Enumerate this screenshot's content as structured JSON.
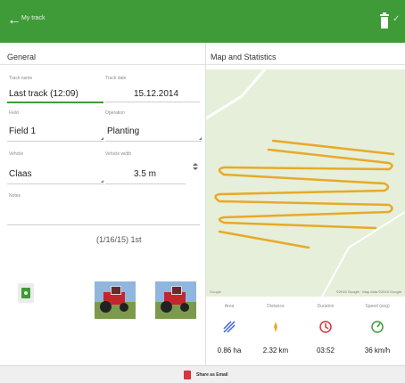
{
  "header": {
    "title": "My track",
    "accent": "#3f9a38"
  },
  "general": {
    "title": "General",
    "track_name_label": "Track name",
    "track_name_value": "Last track (12:09)",
    "track_date_label": "Track date",
    "track_date_value": "15.12.2014",
    "field_label": "Field",
    "field_value": "Field 1",
    "operation_label": "Operation",
    "operation_value": "Planting",
    "vehicle_label": "Vehicle",
    "vehicle_value": "Claas",
    "vehicle_width_label": "Vehicle width",
    "vehicle_width_value": "3.5 m",
    "notes_label": "Notes",
    "duration_text": "(1/16/15) 1st"
  },
  "map_section": {
    "title": "Map and Statistics",
    "attribution": "©2015 Google · Map data ©2015 Google",
    "google": "Google",
    "map_bg": "#e6efd9",
    "track_color": "#e8a928"
  },
  "stats": {
    "area": {
      "label": "Area",
      "value": "0.86 ha",
      "icon": "area-icon",
      "color": "#3b63d6"
    },
    "distance": {
      "label": "Distance",
      "value": "2.32 km",
      "icon": "distance-icon",
      "color": "#e8a928"
    },
    "duration": {
      "label": "Duration",
      "value": "03:52",
      "icon": "clock-icon",
      "color": "#d8323a"
    },
    "speed": {
      "label": "Speed (avg)",
      "value": "36 km/h",
      "icon": "speedometer-icon",
      "color": "#3f9a38"
    }
  },
  "bottom": {
    "share_label": "Share as Email"
  }
}
